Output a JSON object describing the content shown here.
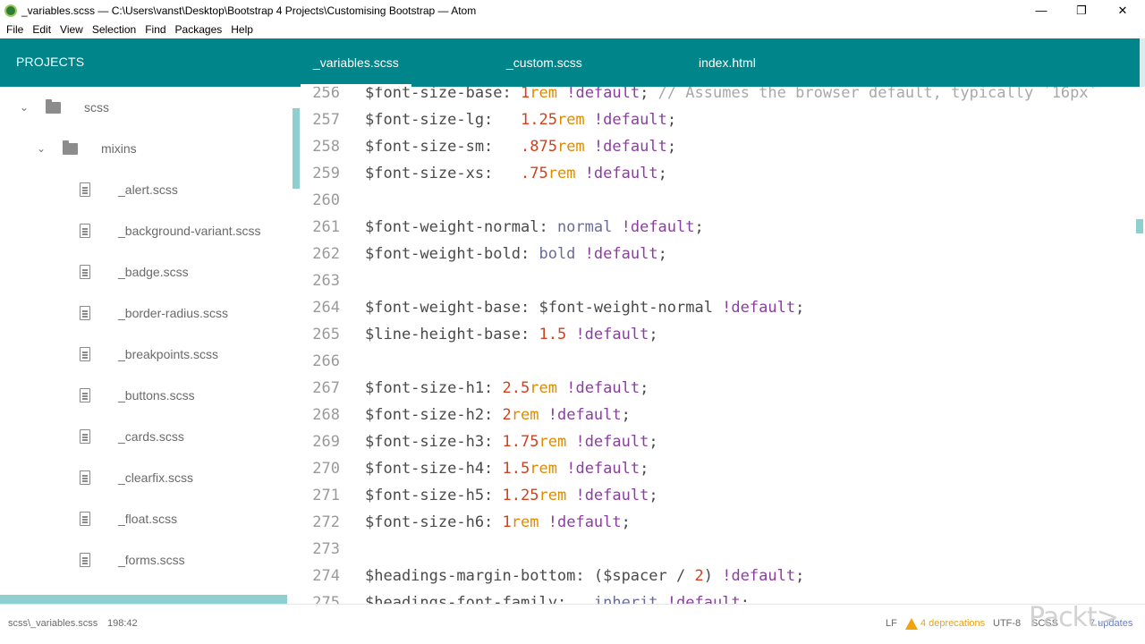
{
  "window": {
    "title": "_variables.scss — C:\\Users\\vanst\\Desktop\\Bootstrap 4 Projects\\Customising Bootstrap — Atom",
    "minimize_glyph": "—",
    "maximize_glyph": "❐",
    "close_glyph": "✕"
  },
  "menu": [
    "File",
    "Edit",
    "View",
    "Selection",
    "Find",
    "Packages",
    "Help"
  ],
  "sidebar": {
    "title": "PROJECTS",
    "root_folder": "scss",
    "sub_folder": "mixins",
    "files": [
      "_alert.scss",
      "_background-variant.scss",
      "_badge.scss",
      "_border-radius.scss",
      "_breakpoints.scss",
      "_buttons.scss",
      "_cards.scss",
      "_clearfix.scss",
      "_float.scss",
      "_forms.scss"
    ]
  },
  "tabs": [
    {
      "label": "_variables.scss",
      "active": true
    },
    {
      "label": "_custom.scss",
      "active": false
    },
    {
      "label": "index.html",
      "active": false
    }
  ],
  "editor": {
    "lines": [
      {
        "n": "256",
        "tokens": [
          [
            "var",
            "$font-size-base: "
          ],
          [
            "num",
            "1"
          ],
          [
            "unit",
            "rem"
          ],
          [
            "var",
            " "
          ],
          [
            "kw",
            "!default"
          ],
          [
            "var",
            "; "
          ],
          [
            "cm",
            "// Assumes the browser default, typically `16px`"
          ]
        ]
      },
      {
        "n": "257",
        "tokens": [
          [
            "var",
            "$font-size-lg:   "
          ],
          [
            "num",
            "1.25"
          ],
          [
            "unit",
            "rem"
          ],
          [
            "var",
            " "
          ],
          [
            "kw",
            "!default"
          ],
          [
            "var",
            ";"
          ]
        ]
      },
      {
        "n": "258",
        "tokens": [
          [
            "var",
            "$font-size-sm:   "
          ],
          [
            "num",
            ".875"
          ],
          [
            "unit",
            "rem"
          ],
          [
            "var",
            " "
          ],
          [
            "kw",
            "!default"
          ],
          [
            "var",
            ";"
          ]
        ]
      },
      {
        "n": "259",
        "tokens": [
          [
            "var",
            "$font-size-xs:   "
          ],
          [
            "num",
            ".75"
          ],
          [
            "unit",
            "rem"
          ],
          [
            "var",
            " "
          ],
          [
            "kw",
            "!default"
          ],
          [
            "var",
            ";"
          ]
        ]
      },
      {
        "n": "260",
        "tokens": []
      },
      {
        "n": "261",
        "tokens": [
          [
            "var",
            "$font-weight-normal: "
          ],
          [
            "val",
            "normal"
          ],
          [
            "var",
            " "
          ],
          [
            "kw",
            "!default"
          ],
          [
            "var",
            ";"
          ]
        ]
      },
      {
        "n": "262",
        "tokens": [
          [
            "var",
            "$font-weight-bold: "
          ],
          [
            "val",
            "bold"
          ],
          [
            "var",
            " "
          ],
          [
            "kw",
            "!default"
          ],
          [
            "var",
            ";"
          ]
        ]
      },
      {
        "n": "263",
        "tokens": []
      },
      {
        "n": "264",
        "tokens": [
          [
            "var",
            "$font-weight-base: $font-weight-normal "
          ],
          [
            "kw",
            "!default"
          ],
          [
            "var",
            ";"
          ]
        ]
      },
      {
        "n": "265",
        "tokens": [
          [
            "var",
            "$line-height-base: "
          ],
          [
            "num",
            "1.5"
          ],
          [
            "var",
            " "
          ],
          [
            "kw",
            "!default"
          ],
          [
            "var",
            ";"
          ]
        ]
      },
      {
        "n": "266",
        "tokens": []
      },
      {
        "n": "267",
        "tokens": [
          [
            "var",
            "$font-size-h1: "
          ],
          [
            "num",
            "2.5"
          ],
          [
            "unit",
            "rem"
          ],
          [
            "var",
            " "
          ],
          [
            "kw",
            "!default"
          ],
          [
            "var",
            ";"
          ]
        ]
      },
      {
        "n": "268",
        "tokens": [
          [
            "var",
            "$font-size-h2: "
          ],
          [
            "num",
            "2"
          ],
          [
            "unit",
            "rem"
          ],
          [
            "var",
            " "
          ],
          [
            "kw",
            "!default"
          ],
          [
            "var",
            ";"
          ]
        ]
      },
      {
        "n": "269",
        "tokens": [
          [
            "var",
            "$font-size-h3: "
          ],
          [
            "num",
            "1.75"
          ],
          [
            "unit",
            "rem"
          ],
          [
            "var",
            " "
          ],
          [
            "kw",
            "!default"
          ],
          [
            "var",
            ";"
          ]
        ]
      },
      {
        "n": "270",
        "tokens": [
          [
            "var",
            "$font-size-h4: "
          ],
          [
            "num",
            "1.5"
          ],
          [
            "unit",
            "rem"
          ],
          [
            "var",
            " "
          ],
          [
            "kw",
            "!default"
          ],
          [
            "var",
            ";"
          ]
        ]
      },
      {
        "n": "271",
        "tokens": [
          [
            "var",
            "$font-size-h5: "
          ],
          [
            "num",
            "1.25"
          ],
          [
            "unit",
            "rem"
          ],
          [
            "var",
            " "
          ],
          [
            "kw",
            "!default"
          ],
          [
            "var",
            ";"
          ]
        ]
      },
      {
        "n": "272",
        "tokens": [
          [
            "var",
            "$font-size-h6: "
          ],
          [
            "num",
            "1"
          ],
          [
            "unit",
            "rem"
          ],
          [
            "var",
            " "
          ],
          [
            "kw",
            "!default"
          ],
          [
            "var",
            ";"
          ]
        ]
      },
      {
        "n": "273",
        "tokens": []
      },
      {
        "n": "274",
        "tokens": [
          [
            "var",
            "$headings-margin-bottom: ($spacer / "
          ],
          [
            "num",
            "2"
          ],
          [
            "var",
            ") "
          ],
          [
            "kw",
            "!default"
          ],
          [
            "var",
            ";"
          ]
        ]
      },
      {
        "n": "275",
        "tokens": [
          [
            "hl",
            "$headings-font-"
          ],
          [
            "var",
            "family:   "
          ],
          [
            "val",
            "inherit"
          ],
          [
            "var",
            " "
          ],
          [
            "kw",
            "!default"
          ],
          [
            "var",
            ";"
          ]
        ]
      }
    ]
  },
  "status": {
    "file_path": "scss\\_variables.scss",
    "cursor": "198:42",
    "line_ending": "LF",
    "deprecations": "4 deprecations",
    "encoding": "UTF-8",
    "grammar": "SCSS",
    "updates": "7 updates"
  },
  "watermark": "Packt>",
  "colors": {
    "accent": "#00858a",
    "scrollbar": "#8fcfd0",
    "warning": "#f0a30a"
  }
}
